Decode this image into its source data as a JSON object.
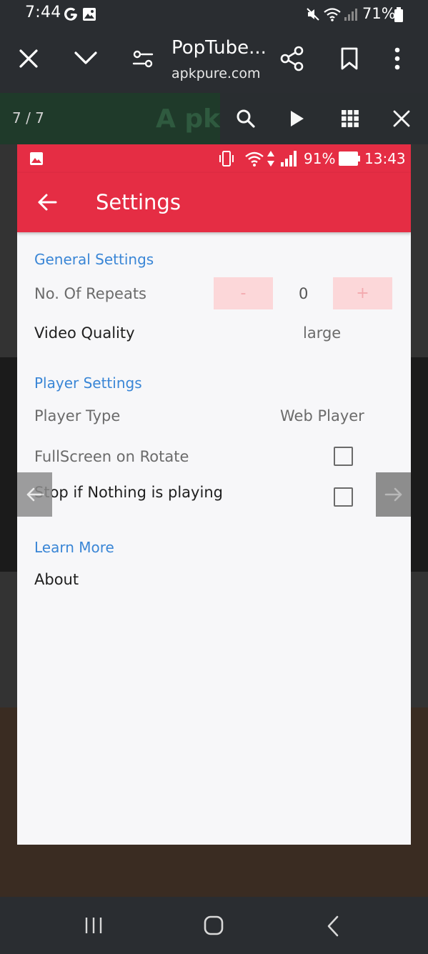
{
  "status_bar": {
    "time": "7:44",
    "battery": "71%"
  },
  "browser": {
    "page_title": "PopTube...",
    "page_domain": "apkpure.com"
  },
  "gallery": {
    "counter": "7 / 7",
    "bg_logo_text": "pk"
  },
  "screenshot": {
    "status_bar": {
      "battery": "91%",
      "time": "13:43"
    },
    "app_bar": {
      "title": "Settings"
    },
    "sections": {
      "general": "General Settings",
      "player": "Player Settings",
      "learn": "Learn More"
    },
    "general": {
      "repeats_label": "No. Of Repeats",
      "repeats_minus": "-",
      "repeats_value": "0",
      "repeats_plus": "+",
      "quality_label": "Video Quality",
      "quality_value": "large"
    },
    "player": {
      "type_label": "Player Type",
      "type_value": "Web Player",
      "fullscreen_label": "FullScreen on Rotate",
      "stop_label": "Stop if Nothing is playing"
    },
    "learn": {
      "about_label": "About"
    }
  }
}
